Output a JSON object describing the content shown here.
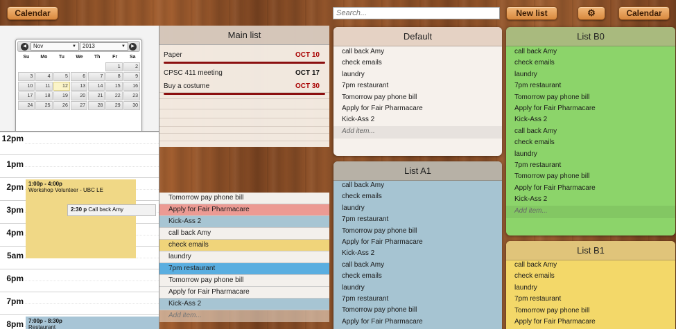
{
  "toolbar": {
    "calendar_left_label": "Calendar",
    "search_placeholder": "Search...",
    "new_list_label": "New list",
    "settings_icon": "gear-icon",
    "calendar_right_label": "Calendar"
  },
  "mini_calendar": {
    "prev_icon": "chevron-left-icon",
    "next_icon": "chevron-right-icon",
    "month": "Nov",
    "year": "2013",
    "weekdays": [
      "Su",
      "Mo",
      "Tu",
      "We",
      "Th",
      "Fr",
      "Sa"
    ],
    "today": "12",
    "days": [
      "",
      "",
      "",
      "",
      "",
      "1",
      "2",
      "3",
      "4",
      "5",
      "6",
      "7",
      "8",
      "9",
      "10",
      "11",
      "12",
      "13",
      "14",
      "15",
      "16",
      "17",
      "18",
      "19",
      "20",
      "21",
      "22",
      "23",
      "24",
      "25",
      "26",
      "27",
      "28",
      "29",
      "30"
    ]
  },
  "day_view": {
    "hours": [
      "12pm",
      "1pm",
      "2pm",
      "3pm",
      "4pm",
      "5am",
      "6pm",
      "7pm",
      "8pm"
    ],
    "events": [
      {
        "time": "1:00p - 4:00p",
        "title": "Workshop Volunteer - UBC LE",
        "color": "#f0d886"
      },
      {
        "time": "2:30 p",
        "title": "Call back Amy",
        "color": "#f2f2f2"
      },
      {
        "time": "7:00p - 8:30p",
        "title": "Restaurant",
        "color": "#a8c5d6"
      }
    ]
  },
  "main_list": {
    "title": "Main list",
    "deadlines": [
      {
        "name": "Paper",
        "date": "OCT 10",
        "accent": "#a80000"
      },
      {
        "name": "CPSC 411 meeting",
        "date": "OCT 17",
        "accent": "#111111"
      },
      {
        "name": "Buy a costume",
        "date": "OCT 30",
        "accent": "#a80000"
      }
    ],
    "items": [
      {
        "text": "Tomorrow pay phone bill",
        "color": "#f3f0ec"
      },
      {
        "text": "Apply for Fair Pharmacare",
        "color": "#ec9a93"
      },
      {
        "text": "Kick-Ass 2",
        "color": "#a7c5d3"
      },
      {
        "text": "call back Amy",
        "color": "#f3f0ec"
      },
      {
        "text": "check emails",
        "color": "#f0d47a"
      },
      {
        "text": "laundry",
        "color": "#f3f0ec"
      },
      {
        "text": "7pm restaurant",
        "color": "#5aaee0"
      },
      {
        "text": "Tomorrow pay phone bill",
        "color": "#f3f0ec"
      },
      {
        "text": "Apply for Fair Pharmacare",
        "color": "#f3f0ec"
      },
      {
        "text": "Kick-Ass 2",
        "color": "#a7c5d3"
      }
    ],
    "add_placeholder": "Add item..."
  },
  "lists": {
    "default": {
      "title": "Default",
      "color": "#f6f1ec",
      "header_color": "#e5d2c4",
      "items": [
        "call back Amy",
        "check emails",
        "laundry",
        "7pm restaurant",
        "Tomorrow pay phone bill",
        "Apply for Fair Pharmacare",
        "Kick-Ass 2"
      ],
      "add_placeholder": "Add item..."
    },
    "a1": {
      "title": "List A1",
      "color": "#a6c4d2",
      "header_color": "#b7b1a6",
      "items": [
        "call back Amy",
        "check emails",
        "laundry",
        "7pm restaurant",
        "Tomorrow pay phone bill",
        "Apply for Fair Pharmacare",
        "Kick-Ass 2",
        "call back Amy",
        "check emails",
        "laundry",
        "7pm restaurant",
        "Tomorrow pay phone bill",
        "Apply for Fair Pharmacare"
      ]
    },
    "b0": {
      "title": "List B0",
      "color": "#8cd46a",
      "header_color": "#a9ba7e",
      "items": [
        "call back Amy",
        "check emails",
        "laundry",
        "7pm restaurant",
        "Tomorrow pay phone bill",
        "Apply for Fair Pharmacare",
        "Kick-Ass 2",
        "call back Amy",
        "check emails",
        "laundry",
        "7pm restaurant",
        "Tomorrow pay phone bill",
        "Apply for Fair Pharmacare",
        "Kick-Ass 2"
      ],
      "add_placeholder": "Add item..."
    },
    "b1": {
      "title": "List B1",
      "color": "#f3d869",
      "header_color": "#e0c47a",
      "items": [
        "call back Amy",
        "check emails",
        "laundry",
        "7pm restaurant",
        "Tomorrow pay phone bill",
        "Apply for Fair Pharmacare"
      ]
    }
  }
}
